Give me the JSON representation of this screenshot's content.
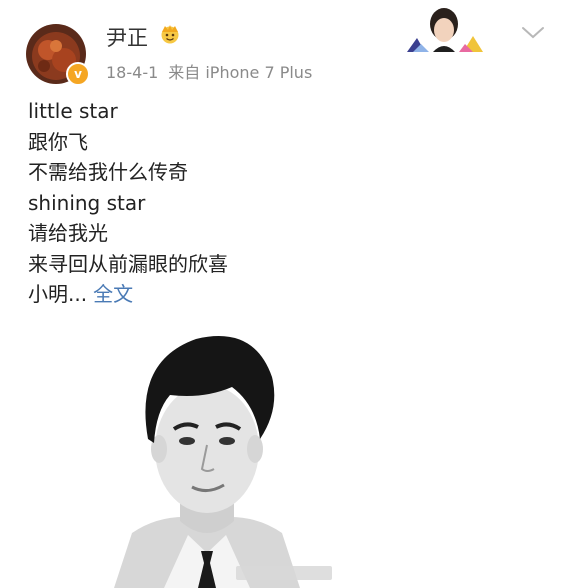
{
  "post": {
    "author": {
      "name": "尹正",
      "verified_badge": "v"
    },
    "meta": {
      "date": "18-4-1",
      "source": "来自 iPhone 7 Plus"
    },
    "text": {
      "lines": [
        "little star",
        "跟你飞",
        "不需给我什么传奇",
        "shining star",
        "请给我光",
        "来寻回从前漏眼的欣喜",
        "小明..."
      ],
      "full_text_link": "全文"
    },
    "icons": {
      "crown": "crown-emoji-icon",
      "menu": "chevron-down-icon",
      "decoration": "avatar-pendant-decoration"
    },
    "colors": {
      "link": "#4a7ab5",
      "meta": "#8a8a8a",
      "badge": "#f5a623"
    }
  }
}
